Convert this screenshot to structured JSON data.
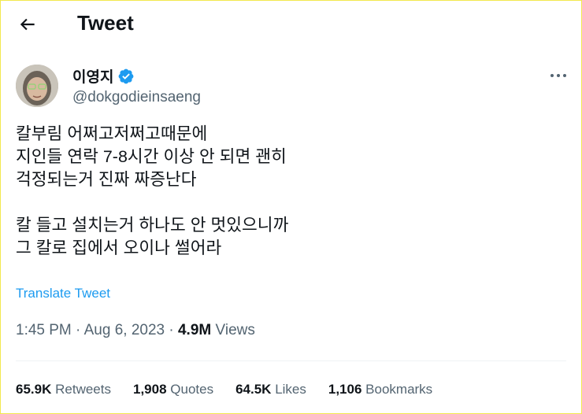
{
  "header": {
    "title": "Tweet",
    "back_icon": "arrow-left-icon"
  },
  "author": {
    "display_name": "이영지",
    "handle": "@dokgodieinsaeng",
    "verified_color": "#1d9bf0",
    "verified_icon": "verified-badge-icon"
  },
  "tweet": {
    "lines": [
      "칼부림 어쩌고저쩌고때문에",
      "지인들 연락 7-8시간 이상 안 되면 괜히",
      "걱정되는거 진짜 짜증난다",
      "",
      "칼 들고 설치는거 하나도 안 멋있으니까",
      "그 칼로 집에서 오이나 썰어라"
    ],
    "translate_label": "Translate Tweet"
  },
  "meta": {
    "time": "1:45 PM",
    "separator": "·",
    "date": "Aug 6, 2023",
    "views_count": "4.9M",
    "views_label": "Views"
  },
  "stats": [
    {
      "count": "65.9K",
      "label": "Retweets"
    },
    {
      "count": "1,908",
      "label": "Quotes"
    },
    {
      "count": "64.5K",
      "label": "Likes"
    },
    {
      "count": "1,106",
      "label": "Bookmarks"
    }
  ],
  "colors": {
    "link": "#1d9bf0",
    "secondary_text": "#536471",
    "primary_text": "#0f1419",
    "frame_border": "#f2e94e"
  }
}
